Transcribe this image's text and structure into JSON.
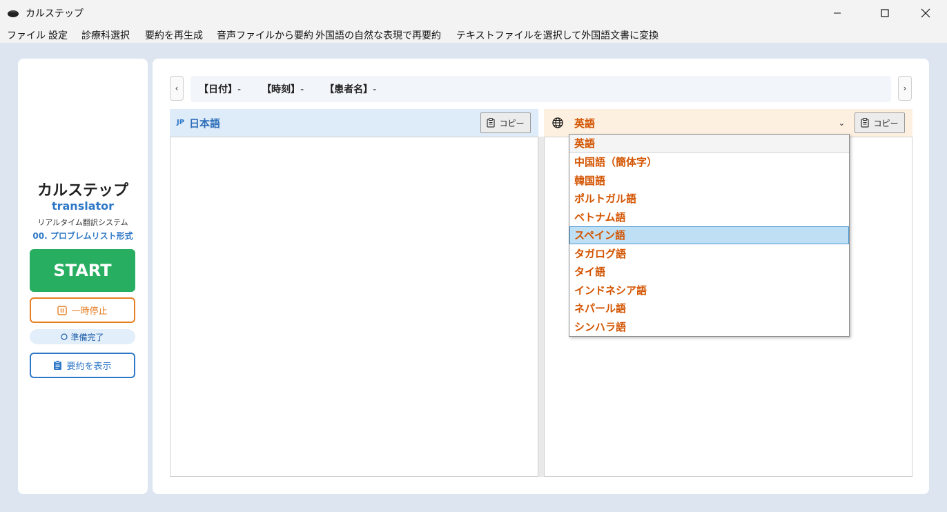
{
  "window": {
    "title": "カルステップ"
  },
  "menu": [
    "ファイル",
    "設定",
    "診療科選択",
    "要約を再生成",
    "音声ファイルから要約",
    "外国語の自然な表現で再要約",
    "テキストファイルを選択して外国語文書に変換"
  ],
  "sidebar": {
    "app_name": "カルステップ",
    "app_sub": "translator",
    "description": "リアルタイム翻訳システム",
    "format": "00. プロブレムリスト形式",
    "start_label": "START",
    "pause_label": "一時停止",
    "status_label": "準備完了",
    "summary_label": "要約を表示"
  },
  "info_bar": {
    "date_label": "【日付】",
    "date_value": "-",
    "time_label": "【時刻】",
    "time_value": "-",
    "patient_label": "【患者名】",
    "patient_value": "-"
  },
  "nav": {
    "prev": "‹",
    "next": "›"
  },
  "left_panel": {
    "lang_code": "JP",
    "lang_label": "日本語",
    "copy_label": "コピー"
  },
  "right_panel": {
    "selected_language": "英語",
    "copy_label": "コピー"
  },
  "dropdown": {
    "options": [
      "英語",
      "中国語（簡体字）",
      "韓国語",
      "ポルトガル語",
      "ベトナム語",
      "スペイン語",
      "タガログ語",
      "タイ語",
      "インドネシア語",
      "ネパール語",
      "シンハラ語"
    ],
    "highlighted": "スペイン語"
  },
  "colors": {
    "accent_blue": "#2f78c7",
    "start_green": "#27ae60",
    "pause_orange": "#e67e22",
    "language_orange": "#d35400"
  }
}
